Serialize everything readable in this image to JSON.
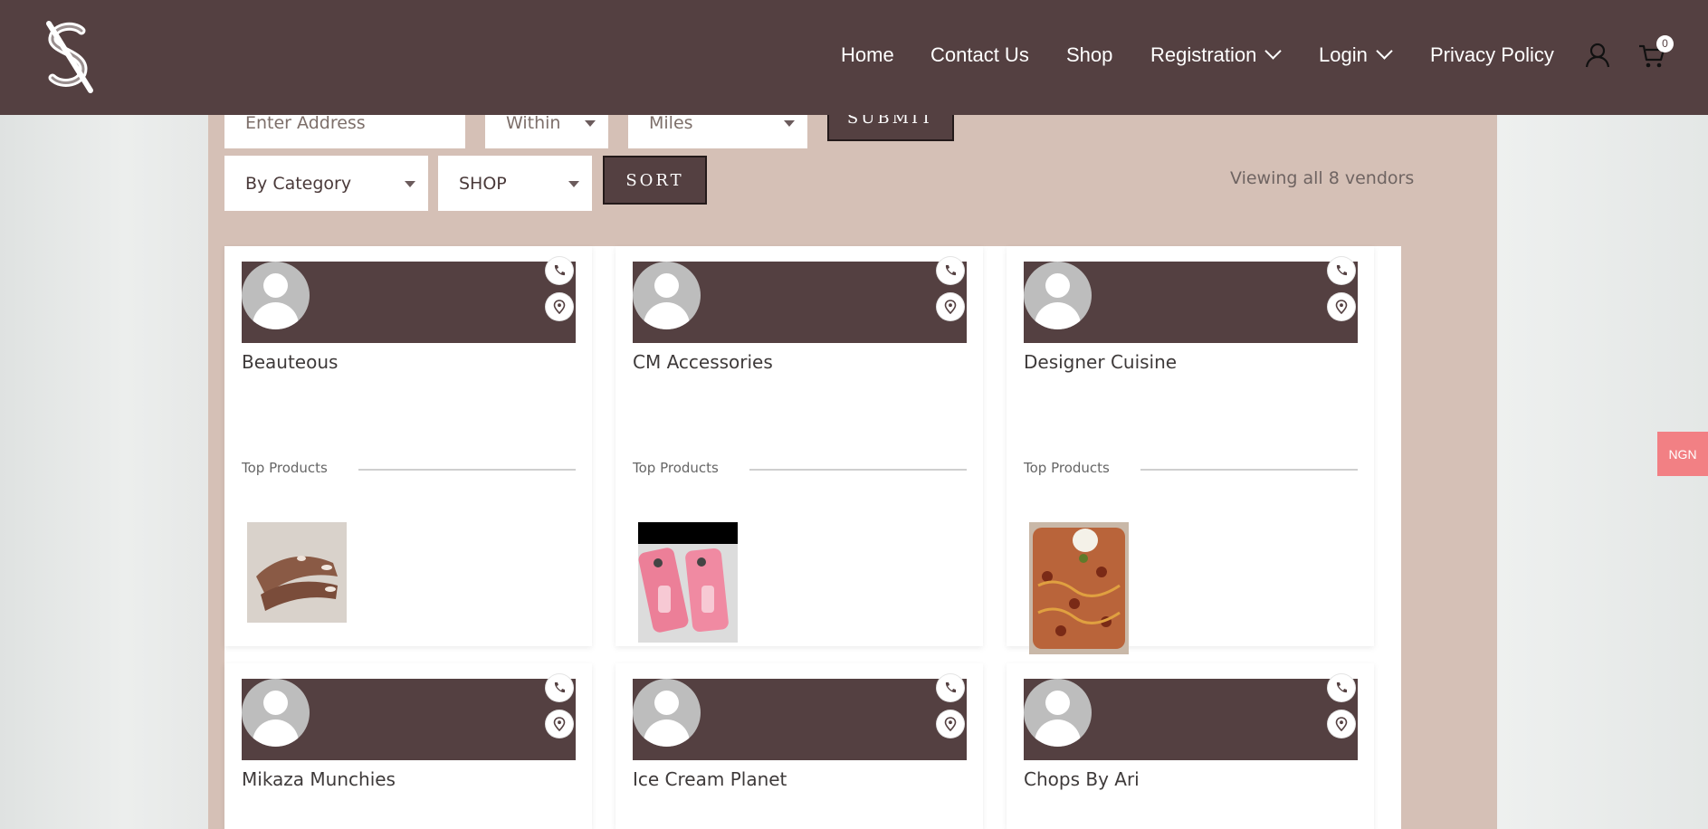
{
  "nav": {
    "home": "Home",
    "contact": "Contact Us",
    "shop": "Shop",
    "registration": "Registration",
    "login": "Login",
    "privacy": "Privacy Policy",
    "cart_count": "0"
  },
  "filters": {
    "address_placeholder": "Enter Address",
    "within": "Within",
    "miles": "Miles",
    "submit": "SUBMIT",
    "category": "By Category",
    "shop": "SHOP",
    "sort": "SORT",
    "viewing": "Viewing all 8 vendors"
  },
  "vendors": [
    {
      "name": "Beauteous",
      "top_products_label": "Top Products",
      "thumb": "manicured-hands"
    },
    {
      "name": "CM Accessories",
      "top_products_label": "Top Products",
      "thumb": "pink-phone-cases"
    },
    {
      "name": "Designer Cuisine",
      "top_products_label": "Top Products",
      "thumb": "noodle-dish"
    },
    {
      "name": "Mikaza Munchies"
    },
    {
      "name": "Ice Cream Planet"
    },
    {
      "name": "Chops By Ari"
    }
  ],
  "currency": "NGN",
  "icons": [
    "logo-icon",
    "user-icon",
    "cart-icon",
    "phone-icon",
    "location-pin-icon",
    "chevron-down-icon"
  ],
  "colors": {
    "header": "#544041",
    "panel": "#d5c0b6",
    "currency_tab": "#f28084"
  }
}
